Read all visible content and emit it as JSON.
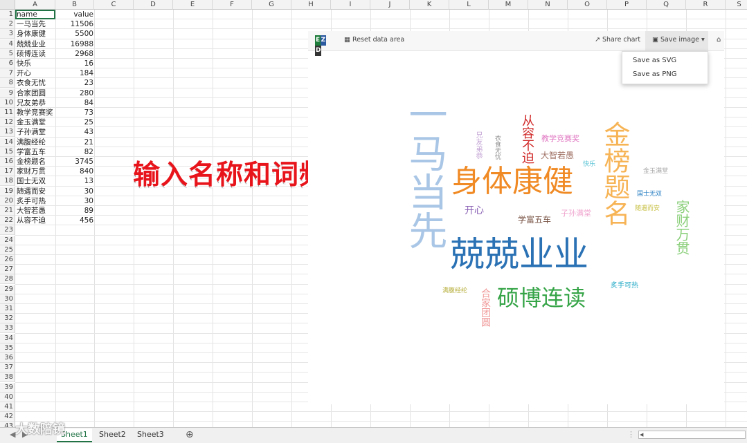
{
  "spreadsheet": {
    "columns": [
      "A",
      "B",
      "C",
      "D",
      "E",
      "F",
      "G",
      "H",
      "I",
      "J",
      "K",
      "L",
      "M",
      "N",
      "O",
      "P",
      "Q",
      "R",
      "S"
    ],
    "header": [
      "name",
      "value"
    ],
    "rows": [
      [
        "一马当先",
        "11506"
      ],
      [
        "身体康健",
        "5500"
      ],
      [
        "兢兢业业",
        "16988"
      ],
      [
        "硕博连读",
        "2968"
      ],
      [
        "快乐",
        "16"
      ],
      [
        "开心",
        "184"
      ],
      [
        "衣食无忧",
        "23"
      ],
      [
        "合家团圆",
        "280"
      ],
      [
        "兄友弟恭",
        "84"
      ],
      [
        "教学竞赛奖",
        "73"
      ],
      [
        "金玉满堂",
        "25"
      ],
      [
        "子孙满堂",
        "43"
      ],
      [
        "满腹经纶",
        "21"
      ],
      [
        "学富五车",
        "82"
      ],
      [
        "金榜题名",
        "3745"
      ],
      [
        "家财万贯",
        "840"
      ],
      [
        "国士无双",
        "13"
      ],
      [
        "随遇而安",
        "30"
      ],
      [
        "炙手可热",
        "30"
      ],
      [
        "大智若愚",
        "89"
      ],
      [
        "从容不迫",
        "456"
      ]
    ],
    "row_numbers": [
      "1",
      "2",
      "3",
      "4",
      "5",
      "6",
      "7",
      "8",
      "9",
      "10",
      "11",
      "12",
      "13",
      "14",
      "15",
      "16",
      "17",
      "18",
      "19",
      "20",
      "21",
      "22",
      "23",
      "24",
      "25",
      "26",
      "27",
      "28",
      "29",
      "30",
      "31",
      "32",
      "33",
      "34",
      "35",
      "36",
      "37",
      "38",
      "39",
      "40",
      "41",
      "42",
      "43"
    ]
  },
  "overlay_text": "输入名称和词频",
  "chart_toolbar": {
    "logo": "EXCEL",
    "reset": "Reset data area",
    "share": "Share chart",
    "save": "Save image",
    "home_icon": "home-icon"
  },
  "save_menu": {
    "svg": "Save as SVG",
    "png": "Save as PNG"
  },
  "wordcloud": [
    {
      "text": "兢兢业业",
      "color": "#2b72b5"
    },
    {
      "text": "一马当先",
      "color": "#a9c6e6"
    },
    {
      "text": "身体康健",
      "color": "#f08a24"
    },
    {
      "text": "金榜题名",
      "color": "#f7b456"
    },
    {
      "text": "硕博连读",
      "color": "#35a447"
    },
    {
      "text": "家财万贯",
      "color": "#8cd07c"
    },
    {
      "text": "从容不迫",
      "color": "#d12b2b"
    },
    {
      "text": "合家团圆",
      "color": "#f19a9a"
    },
    {
      "text": "开心",
      "color": "#8a62b5"
    },
    {
      "text": "学富五车",
      "color": "#7a5547"
    },
    {
      "text": "大智若愚",
      "color": "#a07265"
    },
    {
      "text": "教学竞赛奖",
      "color": "#e077c2"
    },
    {
      "text": "子孙满堂",
      "color": "#f0a6cf"
    },
    {
      "text": "兄友弟恭",
      "color": "#c5a6d6"
    },
    {
      "text": "衣食无忧",
      "color": "#8e8e8e"
    },
    {
      "text": "快乐",
      "color": "#5bc4d6"
    },
    {
      "text": "金玉满堂",
      "color": "#a8a8a8"
    },
    {
      "text": "国士无双",
      "color": "#2d82c4"
    },
    {
      "text": "随遇而安",
      "color": "#c9c24a"
    },
    {
      "text": "满腹经纶",
      "color": "#b8b040"
    },
    {
      "text": "炙手可热",
      "color": "#21a9c6"
    }
  ],
  "sheet_tabs": [
    "Sheet1",
    "Sheet2",
    "Sheet3"
  ],
  "add_sheet_icon": "plus-circle-icon",
  "watermark": "大数陪镜",
  "colors": {
    "excel_green": "#217346"
  }
}
